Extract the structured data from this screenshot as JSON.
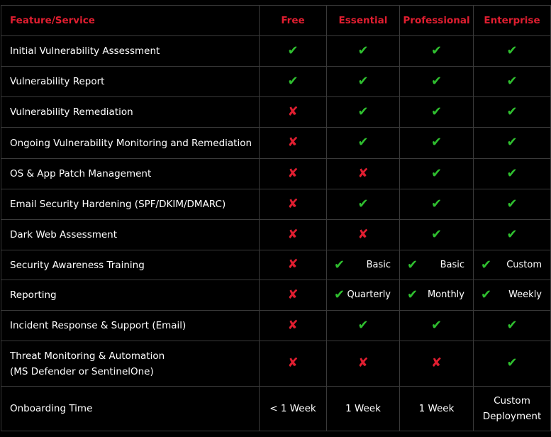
{
  "header": {
    "feature": "Feature/Service",
    "tiers": [
      "Free",
      "Essential",
      "Professional",
      "Enterprise"
    ]
  },
  "glyphs": {
    "yes": "✔",
    "no": "✘"
  },
  "colors": {
    "accent": "#e01e30",
    "yes": "#2fbf2f",
    "grid": "#3a3a3a"
  },
  "rows": [
    {
      "feature": "Initial Vulnerability Assessment",
      "values": [
        "yes",
        "yes",
        "yes",
        "yes"
      ]
    },
    {
      "feature": "Vulnerability Report",
      "values": [
        "yes",
        "yes",
        "yes",
        "yes"
      ]
    },
    {
      "feature": "Vulnerability Remediation",
      "values": [
        "no",
        "yes",
        "yes",
        "yes"
      ]
    },
    {
      "feature": "Ongoing Vulnerability Monitoring and Remediation",
      "values": [
        "no",
        "yes",
        "yes",
        "yes"
      ]
    },
    {
      "feature": "OS & App Patch Management",
      "values": [
        "no",
        "no",
        "yes",
        "yes"
      ]
    },
    {
      "feature": "Email Security Hardening (SPF/DKIM/DMARC)",
      "values": [
        "no",
        "yes",
        "yes",
        "yes"
      ]
    },
    {
      "feature": "Dark Web Assessment",
      "values": [
        "no",
        "no",
        "yes",
        "yes"
      ]
    },
    {
      "feature": "Security Awareness Training",
      "values": [
        "no",
        "yes",
        "yes",
        "yes"
      ],
      "notes": [
        "",
        "Basic",
        "Basic",
        "Custom"
      ]
    },
    {
      "feature": "Reporting",
      "values": [
        "no",
        "yes",
        "yes",
        "yes"
      ],
      "notes": [
        "",
        "Quarterly",
        "Monthly",
        "Weekly"
      ]
    },
    {
      "feature": "Incident Response & Support (Email)",
      "values": [
        "no",
        "yes",
        "yes",
        "yes"
      ]
    },
    {
      "feature_line1": "Threat Monitoring & Automation",
      "feature_line2": "(MS Defender or SentinelOne)",
      "values": [
        "no",
        "no",
        "no",
        "yes"
      ]
    }
  ],
  "onboarding": {
    "label": "Onboarding Time",
    "values": [
      "< 1 Week",
      "1 Week",
      "1 Week"
    ],
    "enterprise_line1": "Custom",
    "enterprise_line2": "Deployment"
  }
}
